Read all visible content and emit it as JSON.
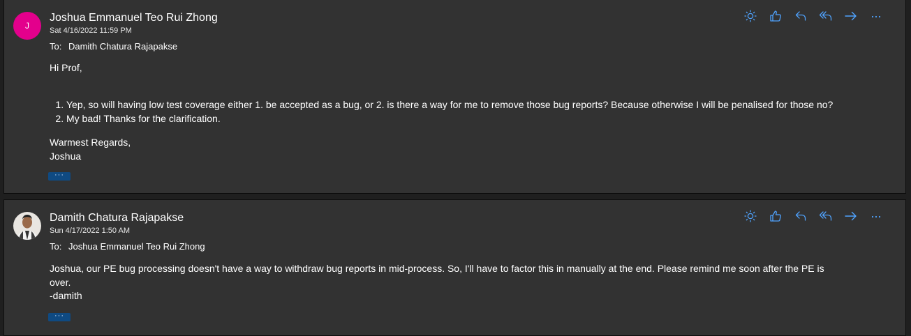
{
  "messages": [
    {
      "sender": "Joshua Emmanuel Teo Rui Zhong",
      "avatar_initial": "J",
      "date": "Sat 4/16/2022 11:59 PM",
      "to_label": "To:",
      "to": "Damith Chatura Rajapakse",
      "greeting": "Hi Prof,",
      "list_items": [
        "Yep, so will having low test coverage either 1. be accepted as a bug, or 2. is there a way for me to remove those bug reports? Because otherwise I will be penalised for those no?",
        "My bad! Thanks for the clarification."
      ],
      "signoff_1": "Warmest Regards,",
      "signoff_2": "Joshua",
      "more": "···"
    },
    {
      "sender": "Damith Chatura Rajapakse",
      "date": "Sun 4/17/2022 1:50 AM",
      "to_label": "To:",
      "to": "Joshua Emmanuel Teo Rui Zhong",
      "body_line_1": "Joshua, our PE bug processing doesn't have a way to withdraw bug reports in mid-process. So, I'll have to factor this in manually at the end. Please remind me soon after the PE is",
      "body_line_2": "over.",
      "body_line_3": "-damith",
      "more": "···"
    }
  ],
  "actions": {
    "icons": [
      "sun-icon",
      "thumbs-up-icon",
      "reply-icon",
      "reply-all-icon",
      "forward-icon",
      "more-icon"
    ],
    "accent_color": "#4fa3ff"
  },
  "colors": {
    "background": "#323232",
    "avatar_pink": "#e3008c",
    "more_pill": "#0f4a82"
  }
}
